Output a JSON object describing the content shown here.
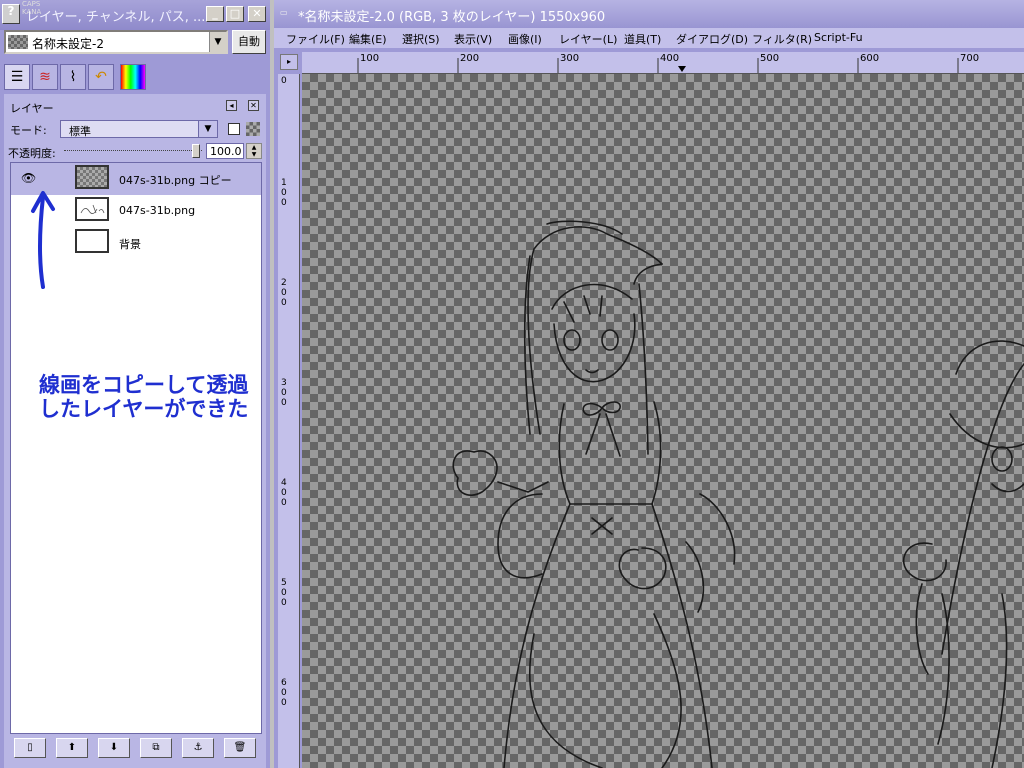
{
  "dock": {
    "title": "レイヤー, チャンネル, パス, ...",
    "caps_indicator": "CAPS\nKANA",
    "image_select_value": "名称未設定-2",
    "auto_button": "自動",
    "tabs": [
      "layers-icon",
      "channels-icon",
      "paths-icon",
      "undo-icon",
      "colormap-icon"
    ],
    "panel": {
      "label": "レイヤー",
      "mode_label": "モード:",
      "mode_value": "標準",
      "opacity_label": "不透明度:",
      "opacity_value": "100.0"
    },
    "layers": [
      {
        "name": "047s-31b.png コピー",
        "visible": true,
        "selected": true,
        "thumb": "checker"
      },
      {
        "name": "047s-31b.png",
        "visible": false,
        "selected": false,
        "thumb": "sketch"
      },
      {
        "name": "背景",
        "visible": false,
        "selected": false,
        "thumb": "white"
      }
    ],
    "annotation": {
      "line1": "線画をコピーして透過",
      "line2": "したレイヤーができた",
      "color": "#1f2fd0"
    },
    "bottom_buttons": [
      "new-layer-icon",
      "raise-layer-icon",
      "lower-layer-icon",
      "duplicate-layer-icon",
      "anchor-layer-icon",
      "delete-layer-icon"
    ]
  },
  "image_window": {
    "title": "*名称未設定-2.0 (RGB, 3 枚のレイヤー) 1550x960",
    "menu": [
      "ファイル(F)",
      "編集(E)",
      "選択(S)",
      "表示(V)",
      "画像(I)",
      "レイヤー(L)",
      "道具(T)",
      "ダイアログ(D)",
      "フィルタ(R)",
      "Script-Fu"
    ],
    "hruler_labels": [
      "100",
      "200",
      "300",
      "400",
      "500",
      "600",
      "700"
    ],
    "vruler_labels": [
      "0",
      "100",
      "200",
      "300",
      "400",
      "500",
      "600"
    ]
  },
  "colors": {
    "accent": "#9e9ad6",
    "panel": "#b9b6e4",
    "menubar": "#c3c0ea"
  }
}
